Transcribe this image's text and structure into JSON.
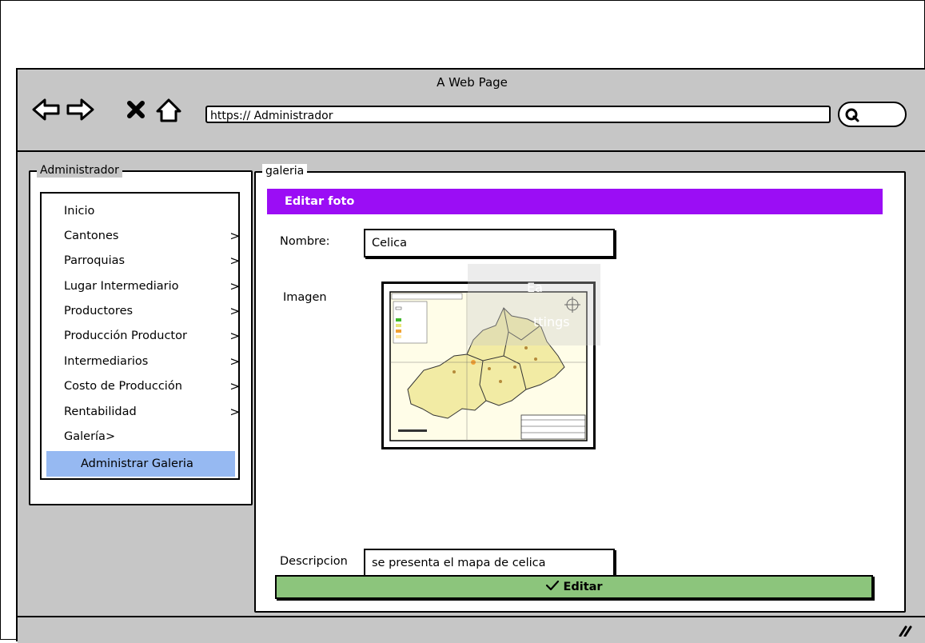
{
  "browser": {
    "title": "A Web Page",
    "url": "https:// Administrador",
    "nav_icons": [
      "back-arrow-icon",
      "forward-arrow-icon",
      "close-x-icon",
      "home-icon"
    ],
    "search_icon": "search-icon"
  },
  "sidebar": {
    "legend": "Administrador",
    "items": [
      {
        "label": "Inicio",
        "chevron": ""
      },
      {
        "label": "Cantones",
        "chevron": ">"
      },
      {
        "label": "Parroquias",
        "chevron": ">"
      },
      {
        "label": "Lugar Intermediario",
        "chevron": ">"
      },
      {
        "label": "Productores",
        "chevron": ">"
      },
      {
        "label": "Producción Productor",
        "chevron": ">"
      },
      {
        "label": "Intermediarios",
        "chevron": ">"
      },
      {
        "label": "Costo de Producción",
        "chevron": ">"
      },
      {
        "label": "Rentabilidad",
        "chevron": ">"
      },
      {
        "label": "Galería>",
        "chevron": ""
      }
    ],
    "active_item": "Administrar Galeria",
    "active_color": "#96b9f2"
  },
  "main": {
    "legend": "galeria",
    "header": "Editar foto",
    "header_color": "#9b0df5",
    "nombre_label": "Nombre:",
    "nombre_value": "Celica",
    "imagen_label": "Imagen",
    "descripcion_label": "Descripcion",
    "descripcion_value": "se presenta el mapa de celica",
    "submit_icon": "check-icon",
    "submit_label": "Editar",
    "submit_color": "#8cc57c"
  },
  "watermark": {
    "line1": "Ea",
    "line2": "ttings"
  }
}
